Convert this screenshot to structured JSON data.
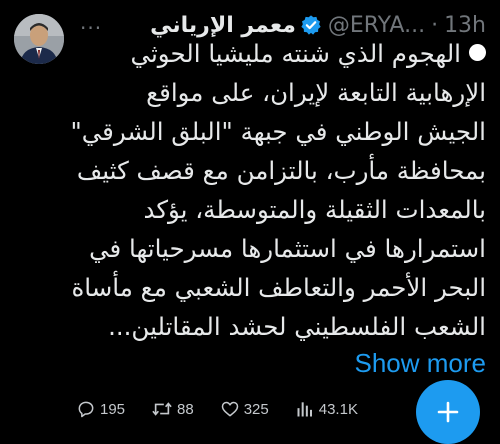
{
  "tweet": {
    "display_name": "معمر الإرياني",
    "handle": "@ERYA...",
    "separator": "·",
    "time": "13h",
    "more_indicator": "...",
    "body_lines": [
      "الهجوم الذي شنته مليشيا الحوثي",
      "الإرهابية التابعة لإيران، على مواقع",
      "الجيش الوطني في جبهة \"البلق الشرقي\"",
      "بمحافظة مأرب، بالتزامن مع قصف كثيف",
      "بالمعدات الثقيلة والمتوسطة، يؤكد",
      "استمرارها في استثمارها مسرحياتها في",
      "البحر الأحمر والتعاطف الشعبي مع مأساة",
      "الشعب الفلسطيني لحشد المقاتلين..."
    ],
    "show_more": "Show more"
  },
  "actions": {
    "replies": "195",
    "retweets": "88",
    "likes": "325",
    "views": "43.1K"
  },
  "colors": {
    "background": "#000000",
    "text": "#e7e9ea",
    "muted": "#71767b",
    "accent": "#1d9bf0"
  },
  "icons": {
    "verified": "verified-badge-icon",
    "reply": "reply-icon",
    "retweet": "retweet-icon",
    "like": "heart-icon",
    "views": "views-bar-chart-icon",
    "compose": "plus-icon"
  }
}
